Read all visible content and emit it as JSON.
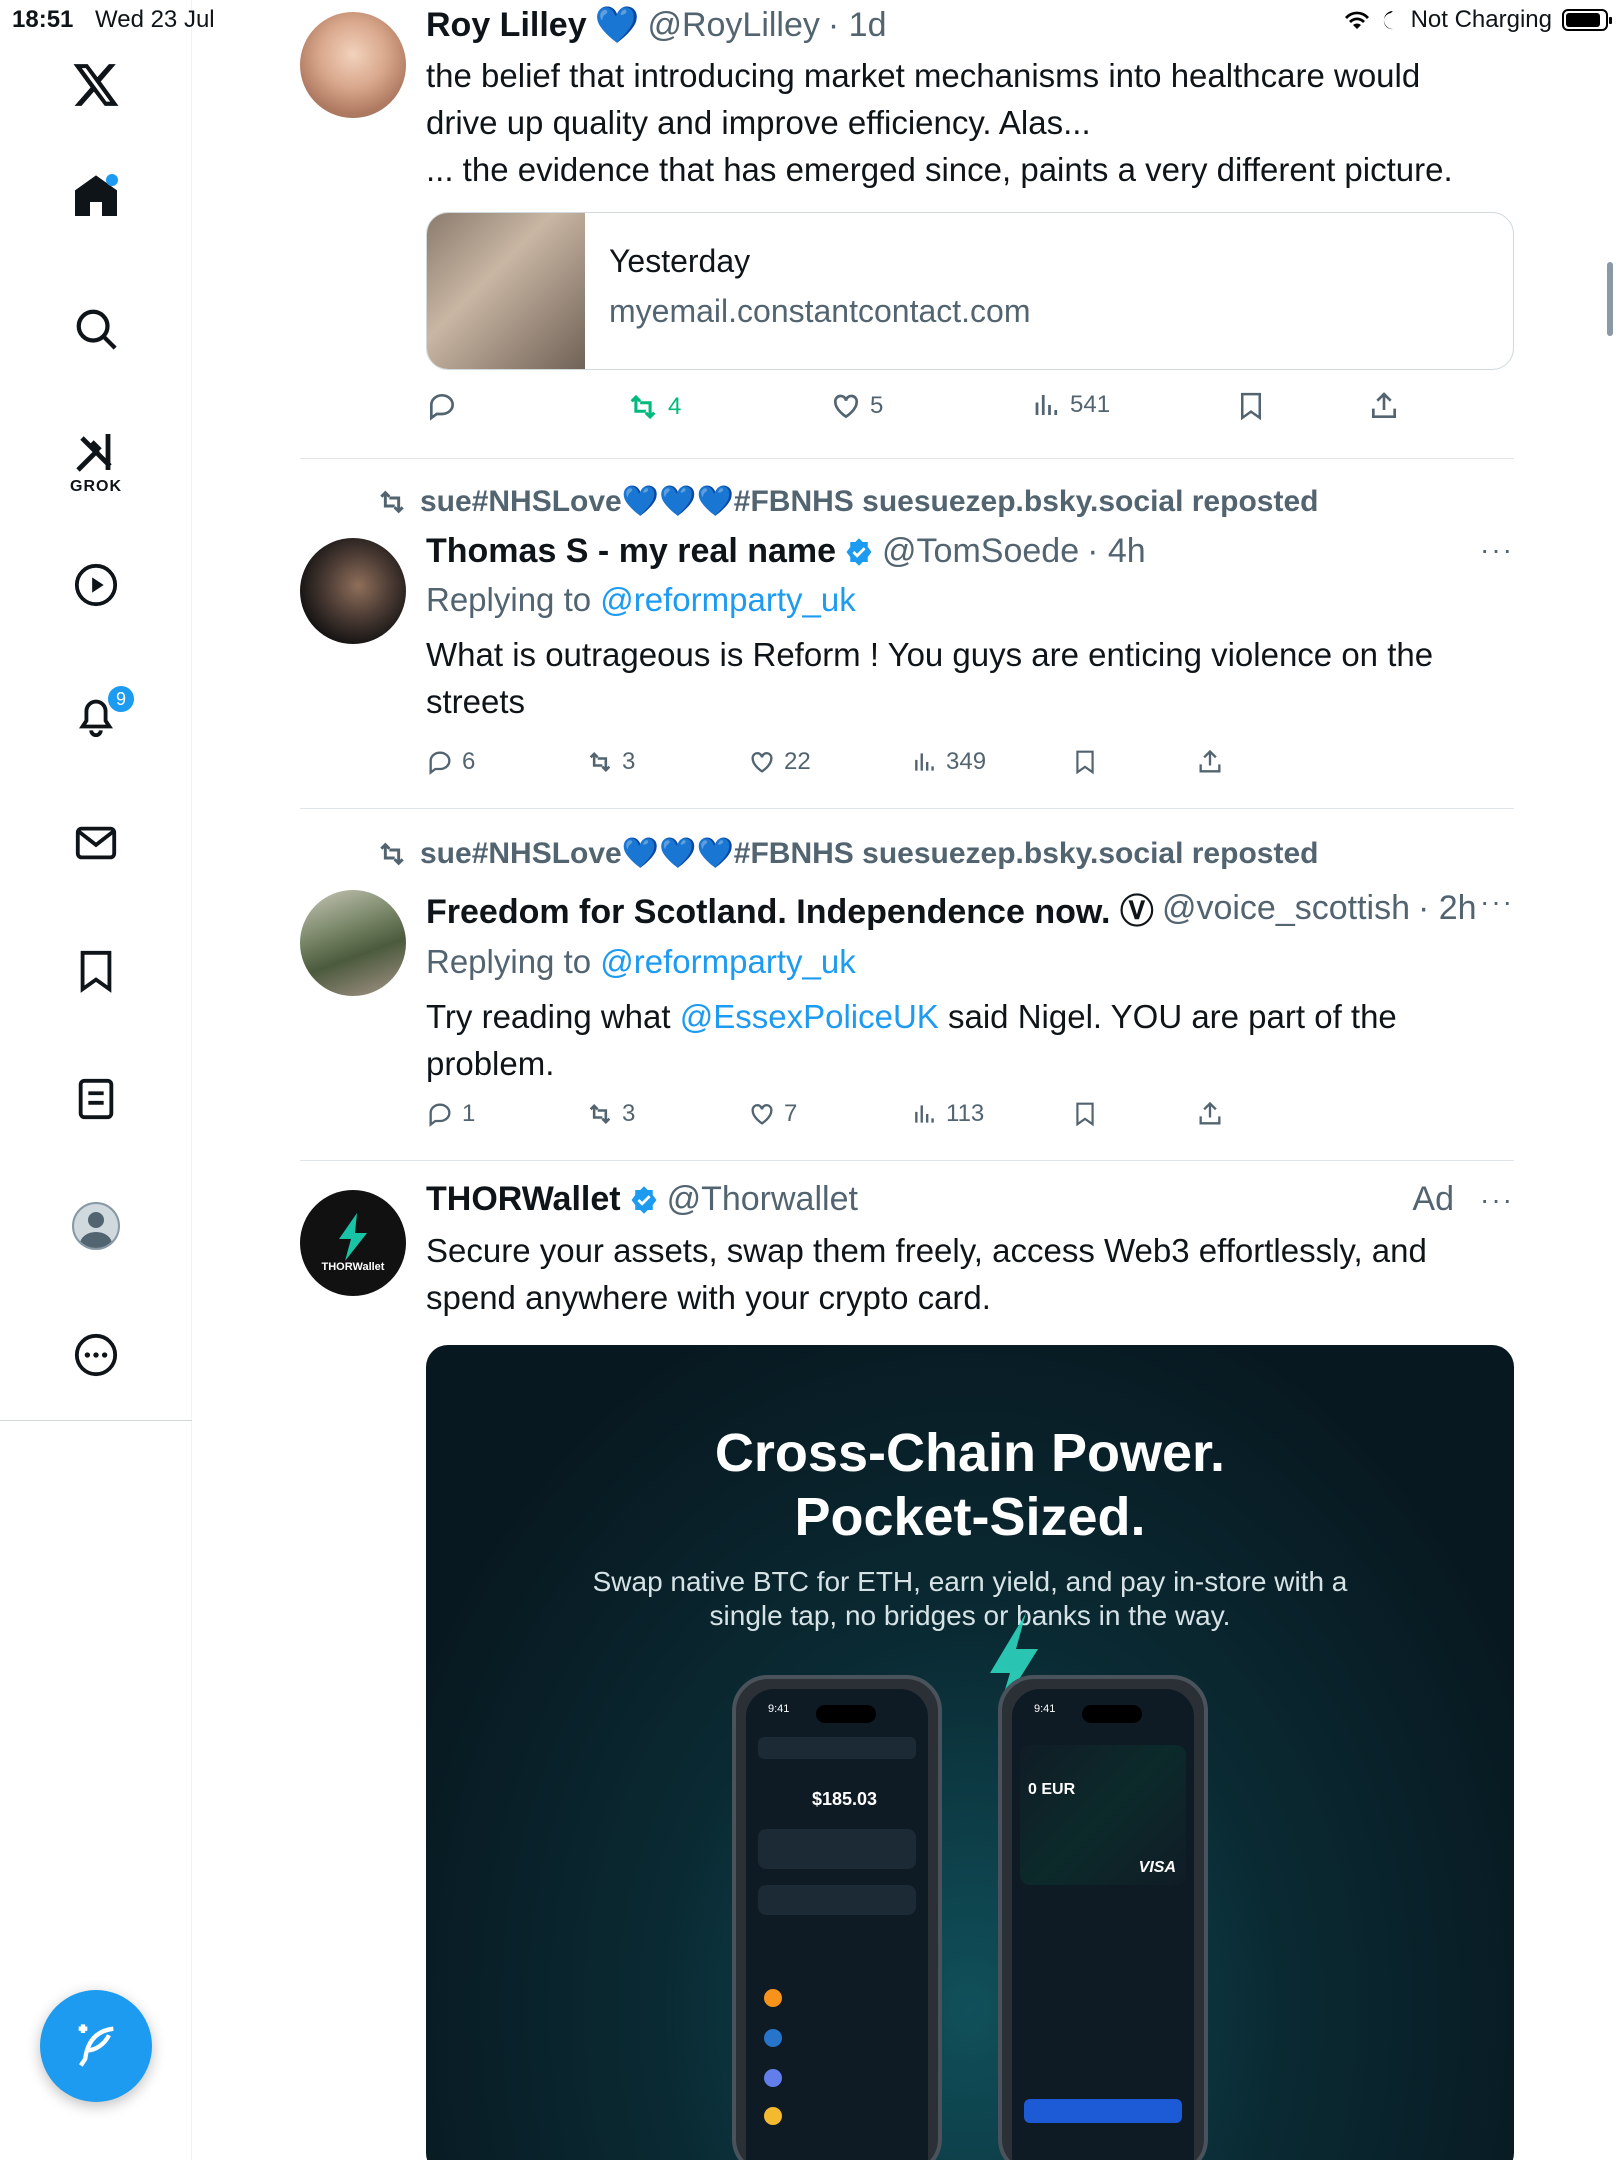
{
  "status_bar": {
    "time": "18:51",
    "date": "Wed 23 Jul",
    "charging": "Not Charging"
  },
  "sidebar": {
    "grok_label": "GROK",
    "notifications_badge": "9"
  },
  "posts": [
    {
      "name": "Roy Lilley",
      "handle": "@RoyLilley",
      "time": "· 1d",
      "text_lines": [
        "the belief that introducing market mechanisms into healthcare would",
        "drive up quality and improve efficiency. Alas...",
        "... the evidence that has emerged since, paints a very different picture."
      ],
      "card": {
        "title": "Yesterday",
        "domain": "myemail.constantcontact.com"
      },
      "actions": {
        "replies": "",
        "reposts": "4",
        "likes": "5",
        "views": "541"
      }
    },
    {
      "repost_by": "sue#NHSLove💙💙💙#FBNHS suesuezep.bsky.social reposted",
      "name": "Thomas S - my real name",
      "handle": "@TomSoede",
      "time": "· 4h",
      "replying_label": "Replying to",
      "replying_to": "@reformparty_uk",
      "text_lines": [
        "What is outrageous is Reform ! You guys are enticing violence on the",
        "streets"
      ],
      "actions": {
        "replies": "6",
        "reposts": "3",
        "likes": "22",
        "views": "349"
      }
    },
    {
      "repost_by": "sue#NHSLove💙💙💙#FBNHS suesuezep.bsky.social reposted",
      "name": "Freedom for Scotland. Independence now. Ⓥ",
      "handle": "@voice_scottish",
      "time": "· 2h",
      "replying_label": "Replying to",
      "replying_to": "@reformparty_uk",
      "text_pre": "Try reading what ",
      "text_mention": "@EssexPoliceUK",
      "text_post": " said Nigel. YOU are part of the",
      "text_line2": "problem.",
      "actions": {
        "replies": "1",
        "reposts": "3",
        "likes": "7",
        "views": "113"
      }
    },
    {
      "name": "THORWallet",
      "handle": "@Thorwallet",
      "ad_label": "Ad",
      "avatar_label": "THORWallet",
      "text_lines": [
        "Secure your assets, swap them freely, access Web3 effortlessly, and",
        "spend anywhere with your crypto card."
      ],
      "ad_image": {
        "headline_1": "Cross-Chain Power.",
        "headline_2": "Pocket-Sized.",
        "subline_1": "Swap native BTC for ETH, earn yield, and pay in-store with a",
        "subline_2": "single tap, no bridges or banks in the way.",
        "phone1_balance": "$185.03",
        "phone2_balance": "0 EUR",
        "phone2_card_brand": "VISA",
        "phone_time": "9:41"
      }
    }
  ],
  "icons": {
    "logo": "x-logo-icon",
    "home": "home-icon",
    "search": "search-icon",
    "grok": "grok-icon",
    "video": "play-icon",
    "notifications": "bell-icon",
    "messages": "mail-icon",
    "bookmarks": "bookmark-icon",
    "lists": "list-icon",
    "profile": "profile-icon",
    "more": "more-circle-icon",
    "compose": "compose-icon"
  },
  "colors": {
    "accent": "#1d9bf0",
    "repost_active": "#00ba7c",
    "text": "#0f1419",
    "muted": "#536471"
  }
}
